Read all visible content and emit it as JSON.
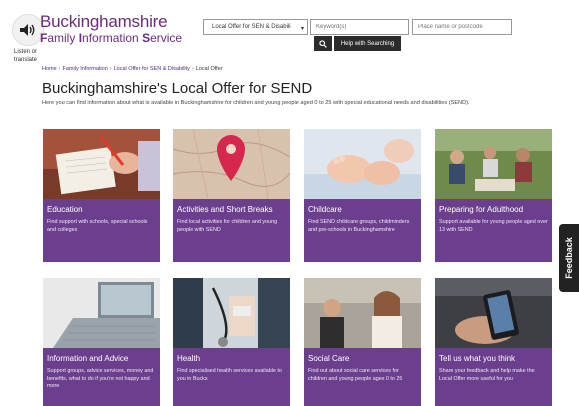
{
  "header": {
    "listen_label_1": "Listen or",
    "listen_label_2": "translate",
    "logo_title": "Buckinghamshire",
    "logo_sub_parts": [
      "F",
      "amily ",
      "I",
      "nformation ",
      "S",
      "ervice"
    ]
  },
  "search": {
    "category_selected": "Local Offer for SEN & Disabili",
    "keyword_placeholder": "Keyword(s)",
    "postcode_placeholder": "Place name or postcode",
    "help_label": "Help with Searching"
  },
  "breadcrumb": {
    "items": [
      "Home",
      "Family Information",
      "Local Offer for SEN & Disability",
      "Local Offer"
    ],
    "separator": "›"
  },
  "page": {
    "title": "Buckinghamshire's Local Offer for SEND",
    "intro": "Here you can find information about what is available in Buckinghamshire for children and young people aged 0 to 25 with special educational needs and disabilities (SEND)."
  },
  "cards": [
    {
      "title": "Education",
      "desc": "Find support with schools, special schools and colleges"
    },
    {
      "title": "Activities and Short Breaks",
      "desc": "Find local activities for children and young people with SEND"
    },
    {
      "title": "Childcare",
      "desc": "Find SEND childcare groups, childminders and pre-schools in Buckinghamshire"
    },
    {
      "title": "Preparing for Adulthood",
      "desc": "Support available for young people aged over 13 with SEND"
    },
    {
      "title": "Information and Advice",
      "desc": "Support groups, advice services, money and benefits, what to do if you're not happy and more"
    },
    {
      "title": "Health",
      "desc": "Find specialised health services available to you in Bucks"
    },
    {
      "title": "Social Care",
      "desc": "Find out about social care services for children and young people ages 0 to 25"
    },
    {
      "title": "Tell us what you think",
      "desc": "Share your feedback and help make the Local Offer more useful for you"
    }
  ],
  "feedback_label": "Feedback",
  "colors": {
    "brand_purple": "#6a2c7d",
    "card_purple": "#6b3f8e",
    "dark": "#2b2b2b"
  }
}
